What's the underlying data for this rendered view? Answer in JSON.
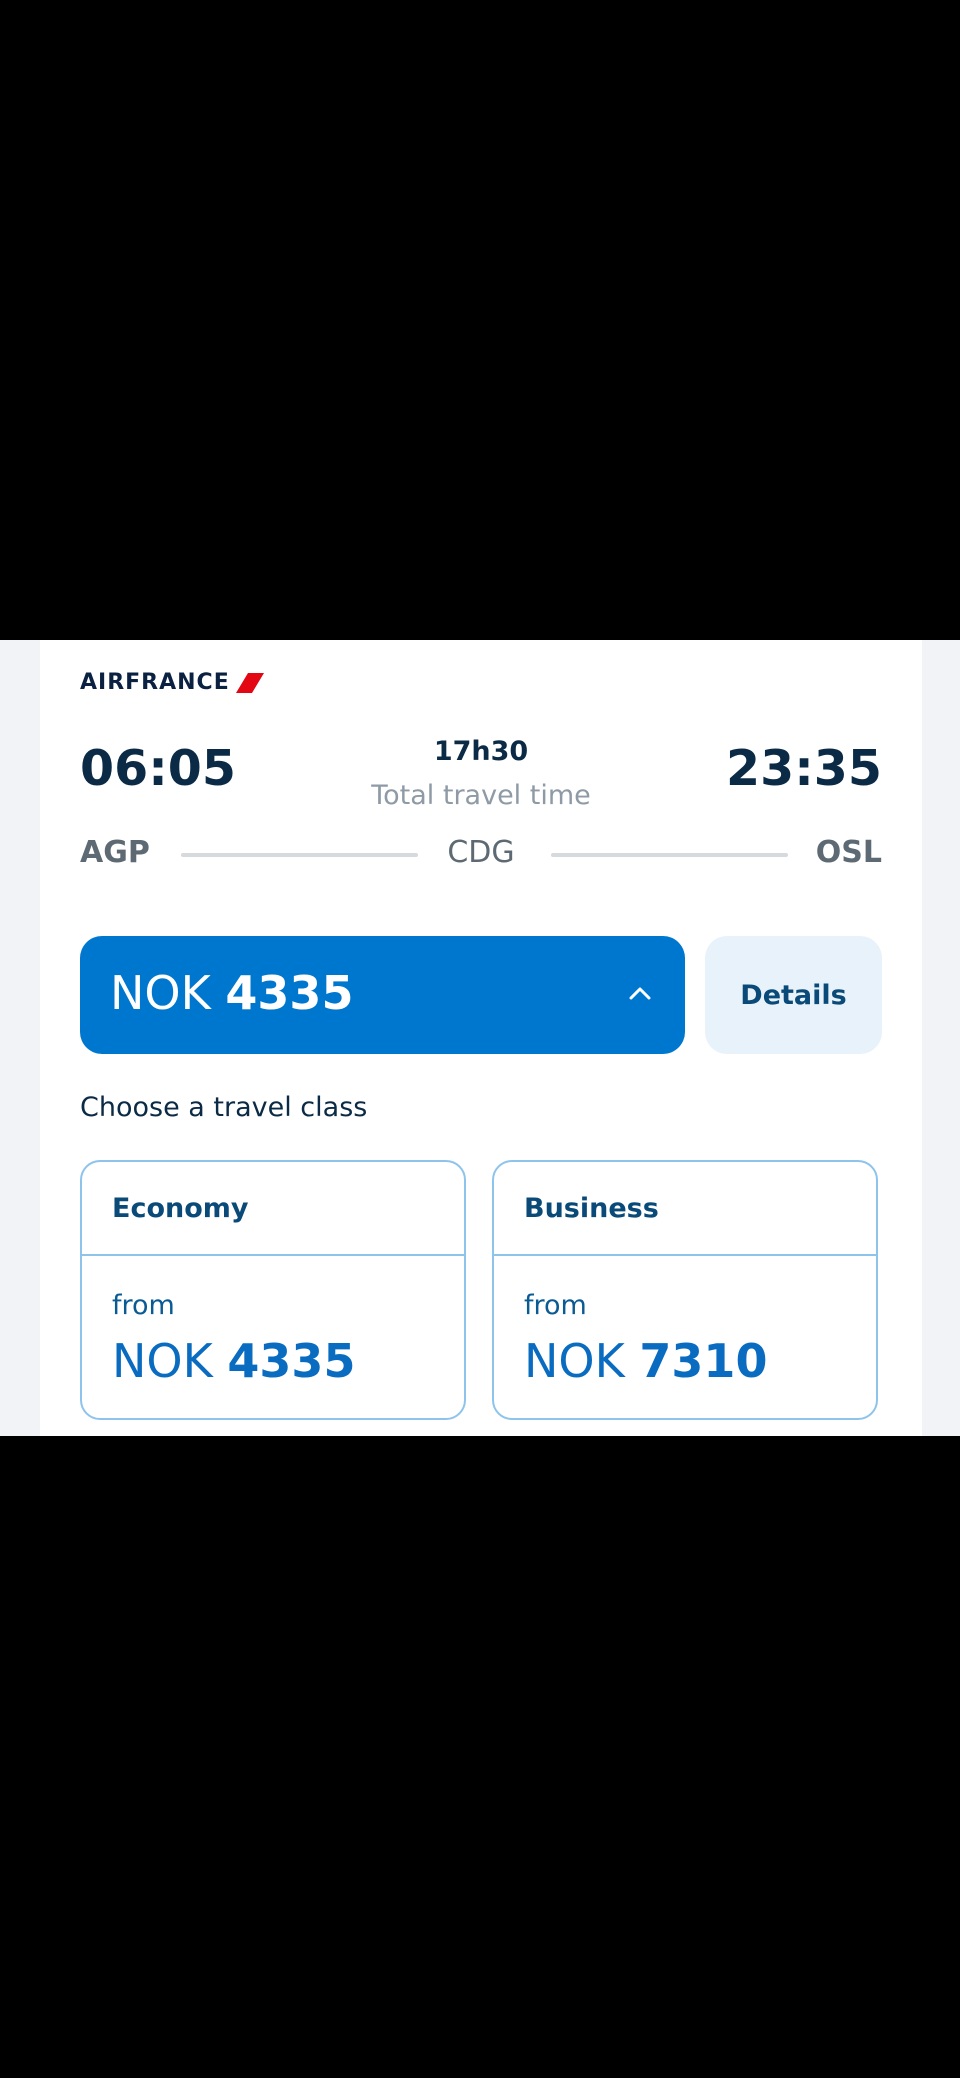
{
  "airline": {
    "logo_text": "AIRFRANCE",
    "accent_color": "#e30613"
  },
  "itinerary": {
    "departure_time": "06:05",
    "arrival_time": "23:35",
    "duration": "17h30",
    "duration_label": "Total travel time",
    "origin": "AGP",
    "connection": "CDG",
    "destination": "OSL"
  },
  "selected_price": {
    "currency": "NOK",
    "amount": "4335",
    "toggle_icon": "chevron-up-icon"
  },
  "details_button": {
    "label": "Details"
  },
  "travel_class": {
    "heading": "Choose a travel class",
    "options": [
      {
        "name": "Economy",
        "from_label": "from",
        "currency": "NOK",
        "amount": "4335"
      },
      {
        "name": "Business",
        "from_label": "from",
        "currency": "NOK",
        "amount": "7310"
      }
    ]
  },
  "colors": {
    "primary": "#0077cf",
    "secondary_bg": "#e8f2fb",
    "card_border": "#8ec4ec",
    "text_dark": "#0b2a45"
  }
}
